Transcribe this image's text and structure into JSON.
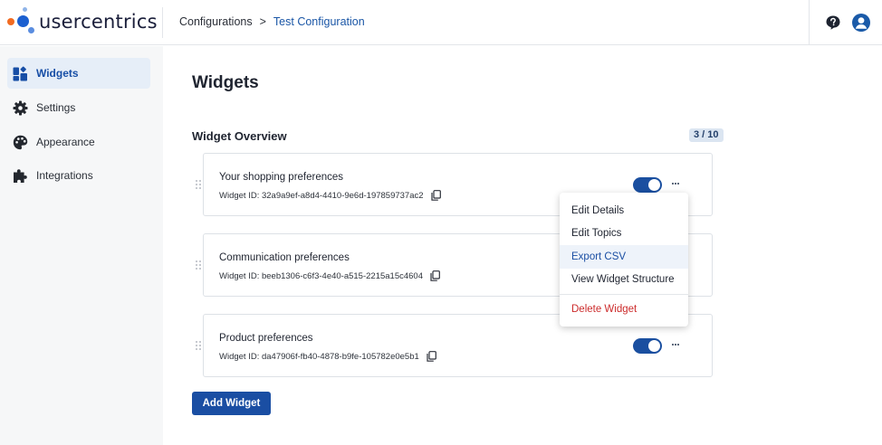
{
  "brand": {
    "name": "usercentrics"
  },
  "breadcrumb": {
    "root": "Configurations",
    "separator": ">",
    "current": "Test Configuration"
  },
  "sidebar": {
    "items": [
      {
        "label": "Widgets",
        "icon": "widgets-icon",
        "active": true
      },
      {
        "label": "Settings",
        "icon": "gear-icon",
        "active": false
      },
      {
        "label": "Appearance",
        "icon": "palette-icon",
        "active": false
      },
      {
        "label": "Integrations",
        "icon": "puzzle-icon",
        "active": false
      }
    ]
  },
  "main": {
    "title": "Widgets",
    "section_title": "Widget Overview",
    "count": "3 / 10",
    "widgets": [
      {
        "title": "Your shopping preferences",
        "id_text": "Widget ID: 32a9a9ef-a8d4-4410-9e6d-197859737ac2",
        "enabled": true
      },
      {
        "title": "Communication preferences",
        "id_text": "Widget ID: beeb1306-c6f3-4e40-a515-2215a15c4604",
        "enabled": true
      },
      {
        "title": "Product preferences",
        "id_text": "Widget ID: da47906f-fb40-4878-b9fe-105782e0e5b1",
        "enabled": true
      }
    ],
    "add_button": "Add Widget"
  },
  "context_menu": {
    "items": [
      "Edit Details",
      "Edit Topics",
      "Export CSV",
      "View Widget Structure"
    ],
    "danger_item": "Delete Widget",
    "hovered": "Export CSV"
  },
  "colors": {
    "accent": "#1a4ea3",
    "danger": "#cc2b2b",
    "sidebar_bg": "#f6f7f8"
  }
}
